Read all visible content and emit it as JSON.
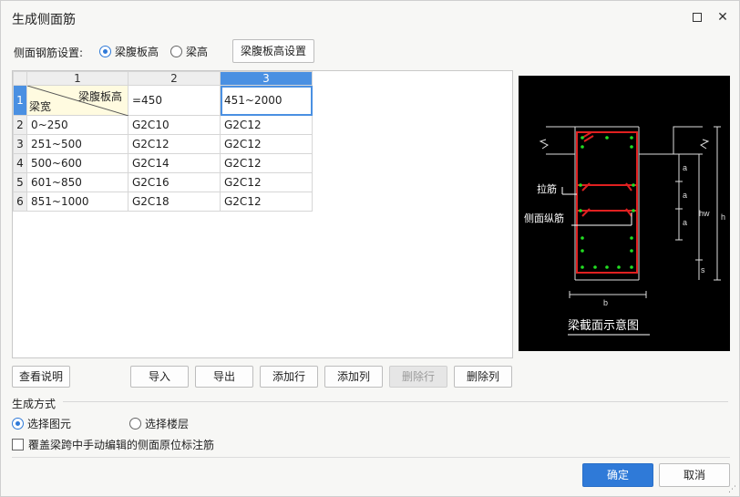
{
  "window": {
    "title": "生成侧面筋",
    "maximize_icon": "maximize-icon",
    "close_label": "✕"
  },
  "setting": {
    "label": "侧面钢筋设置:",
    "option_web_height": "梁腹板高",
    "option_beam_height": "梁高",
    "selected": "梁腹板高",
    "config_button": "梁腹板高设置"
  },
  "grid": {
    "columns": [
      "1",
      "2",
      "3"
    ],
    "header_cell": {
      "top_right": "梁腹板高",
      "bottom_left": "梁宽"
    },
    "first_row": {
      "row_no": "1",
      "col2": "=450",
      "col3": "451~2000"
    },
    "rows": [
      {
        "row_no": "2",
        "width": "0~250",
        "col2": "G2C10",
        "col3": "G2C12"
      },
      {
        "row_no": "3",
        "width": "251~500",
        "col2": "G2C12",
        "col3": "G2C12"
      },
      {
        "row_no": "4",
        "width": "500~600",
        "col2": "G2C14",
        "col3": "G2C12"
      },
      {
        "row_no": "5",
        "width": "601~850",
        "col2": "G2C16",
        "col3": "G2C12"
      },
      {
        "row_no": "6",
        "width": "851~1000",
        "col2": "G2C18",
        "col3": "G2C12"
      }
    ]
  },
  "preview": {
    "tie_label": "拉筋",
    "side_bar_label": "侧面纵筋",
    "caption": "梁截面示意图",
    "dim_a": "a",
    "dim_hw": "hw",
    "dim_h": "h",
    "dim_s": "s",
    "dim_b": "b"
  },
  "buttons": {
    "help": "查看说明",
    "import": "导入",
    "export": "导出",
    "add_row": "添加行",
    "add_col": "添加列",
    "delete_row": "删除行",
    "delete_col": "删除列"
  },
  "generate": {
    "section_label": "生成方式",
    "option_select_element": "选择图元",
    "option_select_floor": "选择楼层",
    "selected": "选择图元",
    "override_label": "覆盖梁跨中手动编辑的侧面原位标注筋",
    "override_checked": false
  },
  "footer": {
    "ok": "确定",
    "cancel": "取消"
  },
  "colors": {
    "accent": "#2f7ad8",
    "selected_header": "#4a90e2",
    "rebar": "#e02020",
    "bar_dot": "#22dd22"
  }
}
